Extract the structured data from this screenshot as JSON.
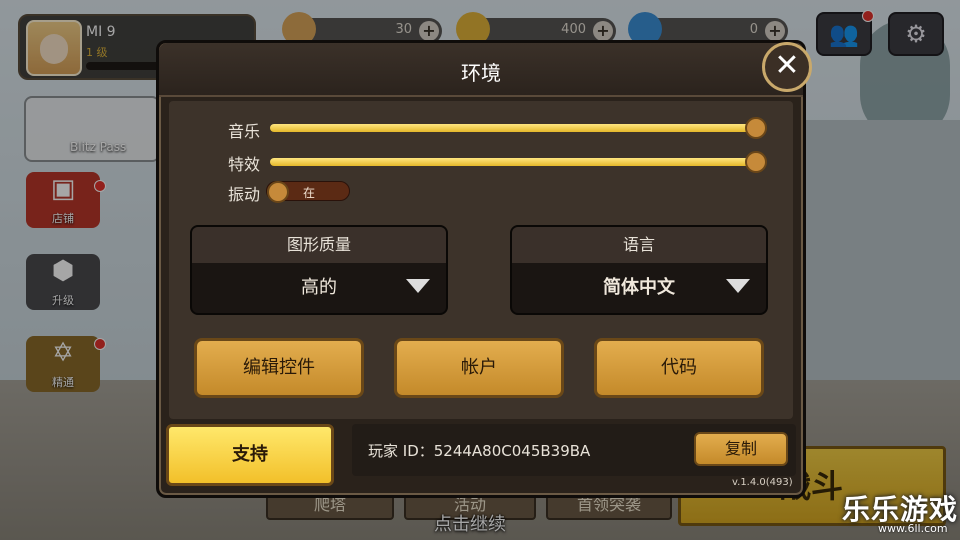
{
  "hud": {
    "player_name": "MI 9",
    "player_level": "1 级",
    "resources": [
      {
        "icon": "bread-icon",
        "value": "30",
        "color": "#d9a55a"
      },
      {
        "icon": "coin-icon",
        "value": "400",
        "color": "#e0b33a"
      },
      {
        "icon": "gem-icon",
        "value": "0",
        "color": "#3b8fd6"
      }
    ],
    "friends_icon": "friends-icon",
    "settings_icon": "gear-icon"
  },
  "side_menu": {
    "pass_label": "Blitz Pass",
    "items": [
      {
        "label": "店铺",
        "icon": "treasure-chest-icon"
      },
      {
        "label": "升级",
        "icon": "anvil-icon"
      },
      {
        "label": "精通",
        "icon": "book-icon"
      }
    ]
  },
  "bottom": {
    "tabs": [
      "爬塔",
      "活动",
      "首领突袭"
    ],
    "battle_label": "战斗",
    "continue_text": "点击继续"
  },
  "watermark": {
    "title": "乐乐游戏",
    "url": "www.6ll.com"
  },
  "settings": {
    "title": "环境",
    "close_icon": "close-icon",
    "music": {
      "label": "音乐",
      "level": 1.0
    },
    "effects": {
      "label": "特效",
      "level": 1.0
    },
    "vibration": {
      "label": "振动",
      "state": "在"
    },
    "graphics": {
      "label": "图形质量",
      "value": "高的"
    },
    "language": {
      "label": "语言",
      "value": "简体中文"
    },
    "buttons": {
      "edit_controls": "编辑控件",
      "account": "帐户",
      "code": "代码"
    },
    "support": "支持",
    "player_id": "玩家 ID：5244A80C045B39BA",
    "copy": "复制",
    "version": "v.1.4.0(493)"
  },
  "colors": {
    "accent": "#e4b82a",
    "panel": "#2a221b",
    "button": "#c48a2a"
  }
}
